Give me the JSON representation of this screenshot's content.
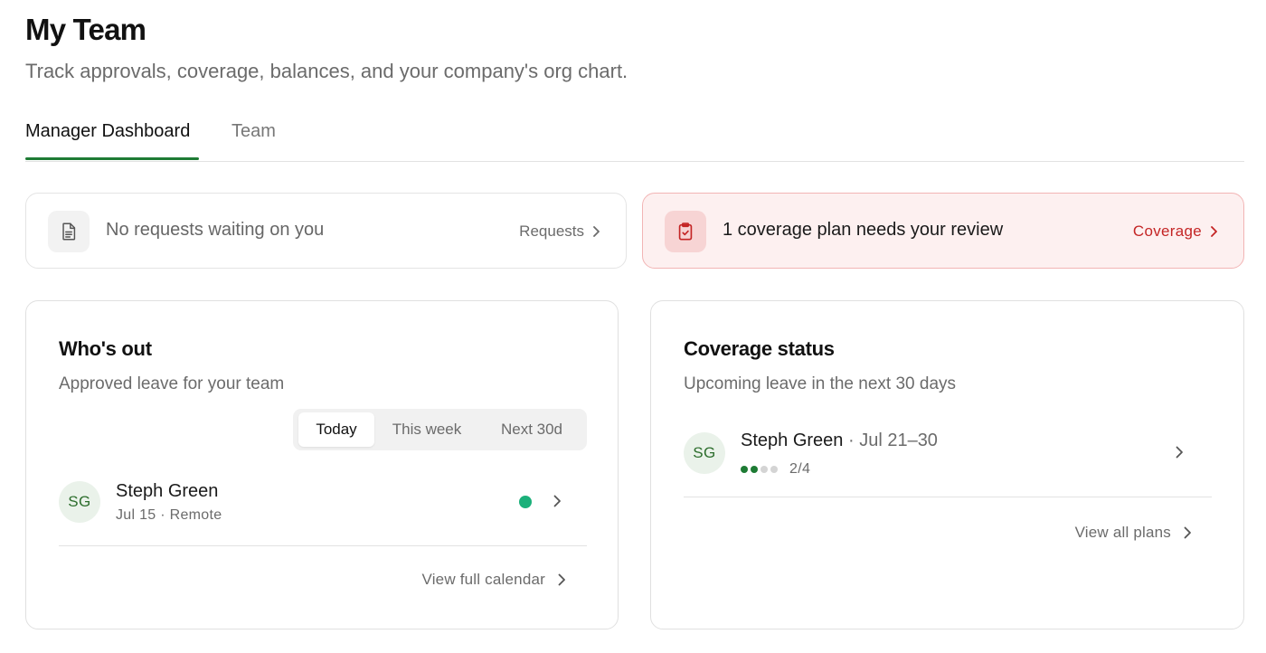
{
  "header": {
    "title": "My Team",
    "subtitle": "Track approvals, coverage, balances, and your company's org chart."
  },
  "tabs": [
    {
      "label": "Manager Dashboard",
      "active": true
    },
    {
      "label": "Team",
      "active": false
    }
  ],
  "banners": {
    "requests": {
      "text": "No requests waiting on you",
      "link_label": "Requests",
      "icon": "document-icon"
    },
    "coverage": {
      "text": "1 coverage plan needs your review",
      "link_label": "Coverage",
      "icon": "clipboard-check-icon",
      "accent_color": "#c42525"
    }
  },
  "whos_out": {
    "title": "Who's out",
    "subtitle": "Approved leave for your team",
    "filters": [
      "Today",
      "This week",
      "Next 30d"
    ],
    "selected_filter": "Today",
    "entries": [
      {
        "initials": "SG",
        "name": "Steph Green",
        "meta": "Jul 15 · Remote",
        "status_color": "#1bb07a"
      }
    ],
    "footer_link": "View full calendar"
  },
  "coverage_status": {
    "title": "Coverage status",
    "subtitle": "Upcoming leave in the next 30 days",
    "entries": [
      {
        "initials": "SG",
        "name": "Steph Green",
        "dates": " · Jul 21–30",
        "progress_filled": 2,
        "progress_total": 4,
        "progress_label": "2/4"
      }
    ],
    "footer_link": "View all plans"
  },
  "colors": {
    "brand_green": "#1e7b34",
    "alert_red": "#c42525",
    "alert_bg": "#fdf0f0"
  }
}
